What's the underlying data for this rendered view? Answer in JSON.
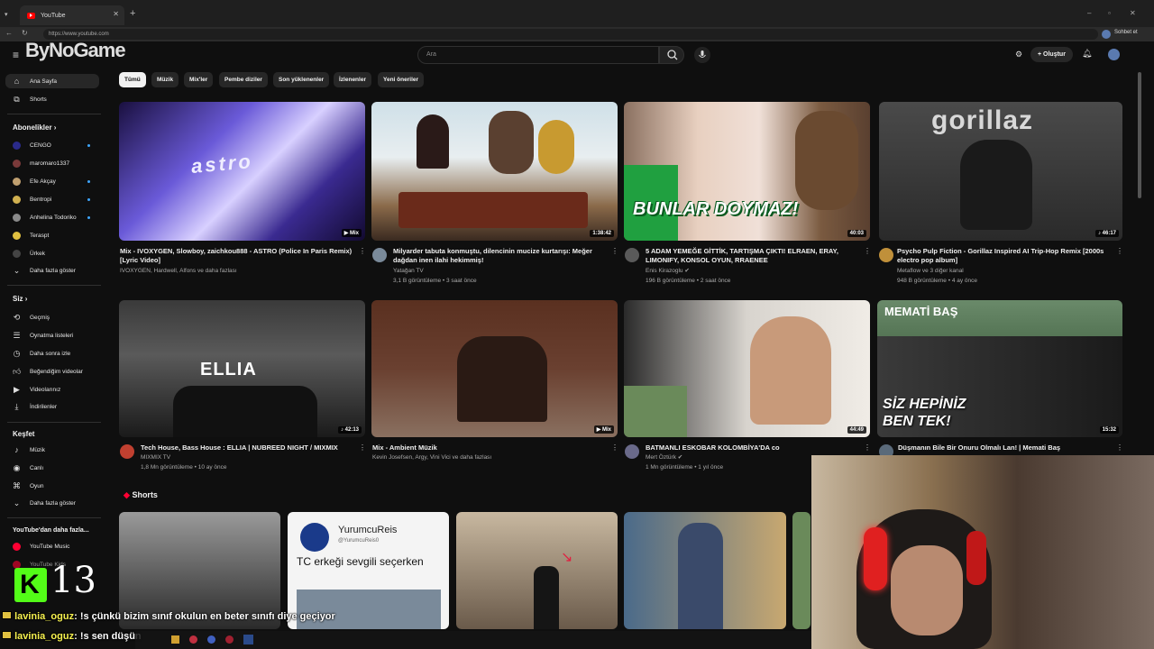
{
  "browser": {
    "tab_title": "YouTube",
    "url": "https://www.youtube.com",
    "chat_button": "Sohbet et"
  },
  "header": {
    "logo_overlay": "ByNoGame",
    "search_placeholder": "Ara",
    "create_label": "Oluştur"
  },
  "sidebar": {
    "home": "Ana Sayfa",
    "shorts": "Shorts",
    "subs_heading": "Abonelikler",
    "subscriptions": [
      {
        "name": "CENGO",
        "color": "#2a2a8a"
      },
      {
        "name": "maromaro1337",
        "color": "#7a3a3a"
      },
      {
        "name": "Efe Akçay",
        "color": "#c0a070"
      },
      {
        "name": "Bentropi",
        "color": "#d0b050"
      },
      {
        "name": "Anhelina Todoriko",
        "color": "#8a8a8a"
      },
      {
        "name": "Teraspt",
        "color": "#e0c040"
      },
      {
        "name": "Ürkek",
        "color": "#444444"
      }
    ],
    "show_more": "Daha fazla göster",
    "you_heading": "Siz",
    "you_items": [
      "Geçmiş",
      "Oynatma listeleri",
      "Daha sonra izle",
      "Beğendiğim videolar",
      "Videolarınız",
      "İndirilenler"
    ],
    "explore_heading": "Keşfet",
    "explore_items": [
      "Müzik",
      "Canlı",
      "Oyun"
    ],
    "explore_more": "Daha fazla göster",
    "more_heading": "YouTube'dan daha fazla...",
    "more_items": [
      "YouTube Music",
      "YouTube Kids"
    ]
  },
  "chips": [
    "Tümü",
    "Müzik",
    "Mix'ler",
    "Pembe diziler",
    "Son yüklenenler",
    "İzlenenler",
    "Yeni öneriler"
  ],
  "videos": [
    {
      "title1": "Mix - IVOXYGEN, Slowboy, zaichkou888 - ASTRO (Police In Paris Remix)",
      "title2": "[Lyric Video]",
      "meta1": "IVOXYGEN, Hardwell, Alfons ve daha fazlası",
      "meta2": "",
      "duration": "Mix",
      "thumb_text": "astro"
    },
    {
      "title1": "Milyarder tabuta konmuştu, dilencinin mucize kurtarışı: Meğer",
      "title2": "dağdan inen ilahi hekimmiş!",
      "meta1": "Yatağan TV",
      "meta2": "3,1 B görüntüleme • 3 saat önce",
      "duration": "1:38:42",
      "thumb_text": ""
    },
    {
      "title1": "5 ADAM YEMEĞE GİTTİK, TARTIŞMA ÇIKTI! ELRAEN, ERAY,",
      "title2": "LIMONIFY, KONSOL OYUN, RRAENEE",
      "meta1": "Enis Kirazoglu",
      "meta2": "196 B görüntüleme • 2 saat önce",
      "duration": "40:03",
      "thumb_text": "BUNLAR DOYMAZ!"
    },
    {
      "title1": "Psycho Pulp Fiction - Gorillaz Inspired AI Trip-Hop Remix [2000s",
      "title2": "electro pop album]",
      "meta1": "Metaflow ve 3 diğer kanal",
      "meta2": "948 B görüntüleme • 4 ay önce",
      "duration": "46:17",
      "thumb_text": "gorillaz"
    },
    {
      "title1": "Tech House, Bass House : ELLIA | NUBREED NIGHT / MIXMIX",
      "title2": "",
      "meta1": "MIXMIX TV",
      "meta2": "1,8 Mn görüntüleme • 10 ay önce",
      "duration": "42:13",
      "thumb_text": "ELLIA"
    },
    {
      "title1": "Mix - Ambient Müzik",
      "title2": "",
      "meta1": "Kevin Josefsen, Argy, Vini Vici ve daha fazlası",
      "meta2": "",
      "duration": "Mix",
      "thumb_text": ""
    },
    {
      "title1": "BATMANLI ESKOBAR KOLOMBİYA'DA co",
      "title2": "",
      "meta1": "Mert Öztürk",
      "meta2": "1 Mn görüntüleme • 1 yıl önce",
      "duration": "44:49",
      "thumb_text": ""
    },
    {
      "title1": "Düşmanın Bile Bir Onuru Olmalı Lan! | Memati Baş",
      "title2": "",
      "meta1": "",
      "meta2": "",
      "duration": "15:32",
      "thumb_text": "SİZ HEPİNİZ BEN TEK!",
      "thumb_text2": "MEMATİ BAŞ"
    }
  ],
  "shorts": {
    "heading": "Shorts",
    "card2_handle": "YurumcuReis0",
    "card2_name": "YurumcuReis",
    "card2_caption": "TC erkeği sevgili seçerken"
  },
  "stream_overlay": {
    "logo_number": "13",
    "chat": [
      {
        "user": "lavinia_oguz",
        "msg": ": !s çünkü bizim sınıf okulun en beter sınıfı diye geçiyor"
      },
      {
        "user": "lavinia_oguz",
        "msg": ": !s sen düşün"
      }
    ]
  }
}
